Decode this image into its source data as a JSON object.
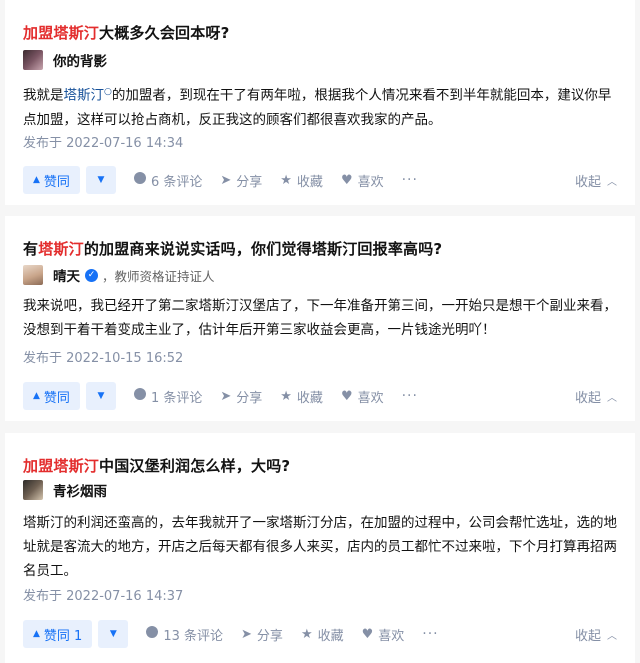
{
  "answers": [
    {
      "title_hl": "加盟塔斯汀",
      "title_rest": "大概多久会回本呀?",
      "author": "你的背影",
      "author_sub": "",
      "body_1": "我就是",
      "body_link": "塔斯汀",
      "body_2": "的加盟者，到现在干了有两年啦，根据我个人情况来看不到半年就能回本，建议你早点加盟，这样可以抢占商机，反正我这的顾客们都很喜欢我家的产品。",
      "date": "发布于 2022-07-16 14:34",
      "vote_label": "赞同",
      "comments": "6 条评论",
      "share": "分享",
      "favorite": "收藏",
      "like": "喜欢",
      "more": "···",
      "collapse": "收起"
    },
    {
      "title_prefix": "有",
      "title_hl": "塔斯汀",
      "title_rest": "的加盟商来说说实话吗，你们觉得塔斯汀回报率高吗?",
      "author": "晴天",
      "author_sub": "，教师资格证持证人",
      "body": "我来说吧，我已经开了第二家塔斯汀汉堡店了，下一年准备开第三间，一开始只是想干个副业来看，没想到干着干着变成主业了，估计年后开第三家收益会更高，一片钱途光明吖！",
      "date": "发布于 2022-10-15 16:52",
      "vote_label": "赞同",
      "comments": "1 条评论",
      "share": "分享",
      "favorite": "收藏",
      "like": "喜欢",
      "more": "···",
      "collapse": "收起"
    },
    {
      "title_hl": "加盟塔斯汀",
      "title_rest": "中国汉堡利润怎么样，大吗?",
      "author": "青衫烟雨",
      "author_sub": "",
      "body": "塔斯汀的利润还蛮高的，去年我就开了一家塔斯汀分店，在加盟的过程中，公司会帮忙选址，选的地址就是客流大的地方，开店之后每天都有很多人来买，店内的员工都忙不过来啦，下个月打算再招两名员工。",
      "date": "发布于 2022-07-16 14:37",
      "vote_label": "赞同 1",
      "comments": "13 条评论",
      "share": "分享",
      "favorite": "收藏",
      "like": "喜欢",
      "more": "···",
      "collapse": "收起"
    }
  ],
  "colors": {
    "accent": "#1772f6",
    "highlight": "#e32d2d",
    "muted": "#8590a6",
    "link": "#175199"
  }
}
